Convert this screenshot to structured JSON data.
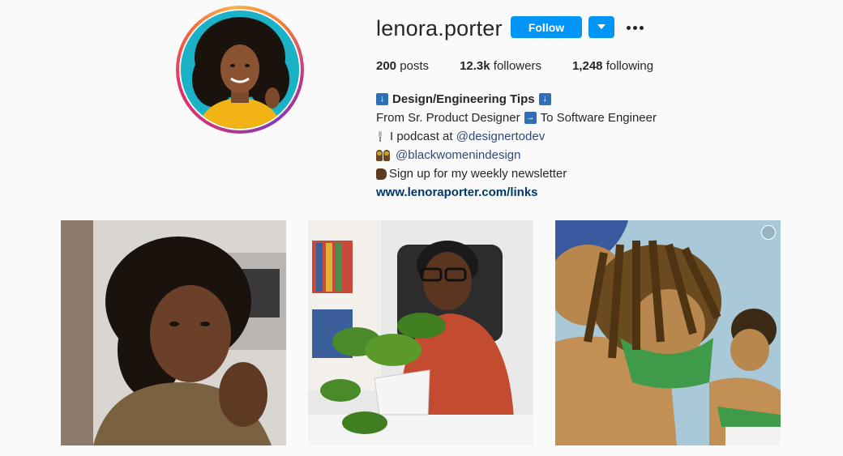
{
  "profile": {
    "username": "lenora.porter",
    "follow_label": "Follow",
    "dropdown_icon": "chevron-down-icon",
    "more_icon": "more-options-icon"
  },
  "stats": {
    "posts_count": "200",
    "posts_label": "posts",
    "followers_count": "12.3k",
    "followers_label": "followers",
    "following_count": "1,248",
    "following_label": "following"
  },
  "bio": {
    "name": "Design/Engineering Tips",
    "line2_prefix": "From Sr. Product Designer",
    "line2_suffix": "To Software Engineer",
    "line3_prefix": "I podcast at",
    "line3_mention": "@designertodev",
    "line4_mention": "@blackwomenindesign",
    "line5": "Sign up for my weekly newsletter",
    "website": "www.lenoraporter.com/links"
  },
  "colors": {
    "accent": "#0095f6",
    "link": "#00376b"
  },
  "posts": [
    {
      "kind": "photo",
      "icon": null
    },
    {
      "kind": "photo",
      "icon": null
    },
    {
      "kind": "illustration",
      "icon": "carousel-icon"
    }
  ]
}
